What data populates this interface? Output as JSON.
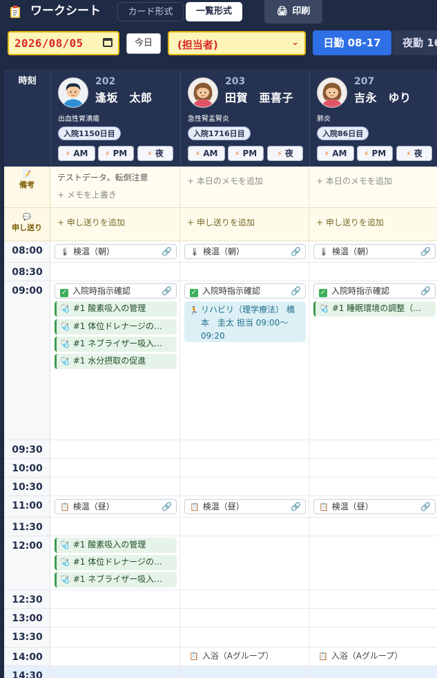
{
  "header": {
    "title": "ワークシート",
    "view_card": "カード形式",
    "view_list": "一覧形式",
    "print": "印刷"
  },
  "toolbar": {
    "date": "2026/08/05",
    "today": "今日",
    "staff": "(担当者)",
    "shift_day": "日勤 08-17",
    "shift_night": "夜勤 16"
  },
  "grid": {
    "time_header": "時刻",
    "memo_label": "備考",
    "handover_label": "申し送り",
    "times": [
      "08:00",
      "08:30",
      "09:00",
      "09:30",
      "10:00",
      "10:30",
      "11:00",
      "11:30",
      "12:00",
      "12:30",
      "13:00",
      "13:30",
      "14:00",
      "14:30"
    ]
  },
  "patients": [
    {
      "room": "202",
      "name": "逢坂　太郎",
      "diagnosis": "出血性胃潰瘍",
      "admission": "入院1150日目",
      "avatar": "male",
      "shifts": [
        "AM",
        "PM",
        "夜"
      ],
      "memo": "テストデータ。転倒注意",
      "memo_action": "+ メモを上書き",
      "handover_action": "+ 申し送りを追加",
      "t0800": "検温（朝）",
      "t0900_check": "入院時指示確認",
      "t0900": [
        "#1 酸素吸入の管理",
        "#1 体位ドレナージの…",
        "#1 ネブライザー吸入…",
        "#1 水分摂取の促進"
      ],
      "t1100": "検温（昼）",
      "t1200": [
        "#1 酸素吸入の管理",
        "#1 体位ドレナージの…",
        "#1 ネブライザー吸入…"
      ]
    },
    {
      "room": "203",
      "name": "田賀　亜喜子",
      "diagnosis": "急性腎盂腎炎",
      "admission": "入院1716日目",
      "avatar": "female",
      "shifts": [
        "AM",
        "PM",
        "夜"
      ],
      "memo_action": "+ 本日のメモを追加",
      "handover_action": "+ 申し送りを追加",
      "t0800": "検温（朝）",
      "t0900_check": "入院時指示確認",
      "t0900_rehab": "リハビリ（理学療法） 橋本　圭太 担当 09:00～09:20",
      "t1100": "検温（昼）",
      "t1400": "入浴（Aグループ）"
    },
    {
      "room": "207",
      "name": "吉永　ゆり",
      "diagnosis": "肺炎",
      "admission": "入院86日目",
      "avatar": "female",
      "shifts": [
        "AM",
        "PM",
        "夜"
      ],
      "memo_action": "+ 本日のメモを追加",
      "handover_action": "+ 申し送りを追加",
      "t0800": "検温（朝）",
      "t0900_check": "入院時指示確認",
      "t0900": [
        "#1 睡眠環境の調整（…"
      ],
      "t1100": "検温（昼）",
      "t1400": "入浴（Aグループ）"
    }
  ],
  "colors": {
    "header_bg": "#1f2a44",
    "accent_blue": "#2f6fe6",
    "field_yellow": "#fdf5b8",
    "task_green": "#e6f3e8",
    "rehab_blue": "#dcf0f6"
  }
}
